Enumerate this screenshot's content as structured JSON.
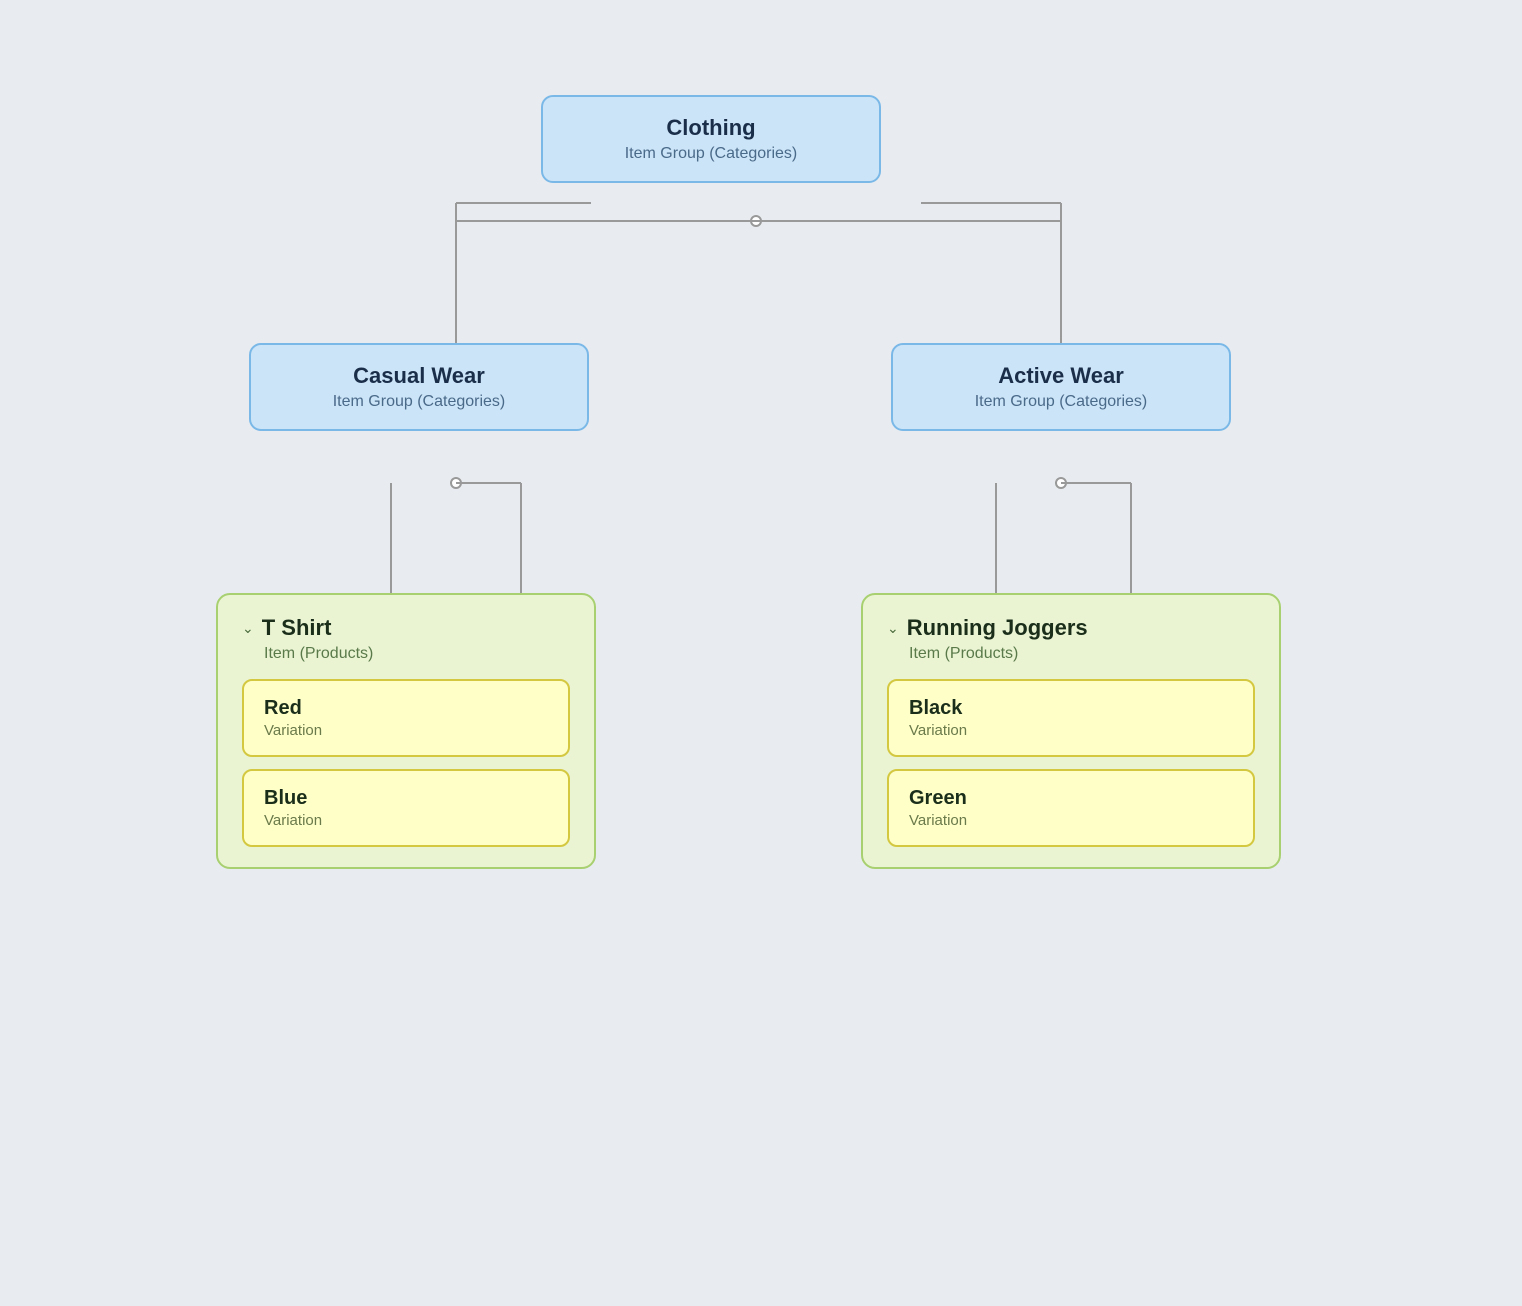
{
  "nodes": {
    "clothing": {
      "title": "Clothing",
      "subtitle": "Item Group (Categories)"
    },
    "casual_wear": {
      "title": "Casual Wear",
      "subtitle": "Item Group (Categories)"
    },
    "active_wear": {
      "title": "Active Wear",
      "subtitle": "Item Group (Categories)"
    },
    "t_shirt": {
      "title": "T Shirt",
      "subtitle": "Item (Products)",
      "variations": [
        {
          "title": "Red",
          "subtitle": "Variation"
        },
        {
          "title": "Blue",
          "subtitle": "Variation"
        }
      ]
    },
    "running_joggers": {
      "title": "Running Joggers",
      "subtitle": "Item (Products)",
      "variations": [
        {
          "title": "Black",
          "subtitle": "Variation"
        },
        {
          "title": "Green",
          "subtitle": "Variation"
        }
      ]
    }
  },
  "chevron": "›",
  "arrow_down": "▾"
}
